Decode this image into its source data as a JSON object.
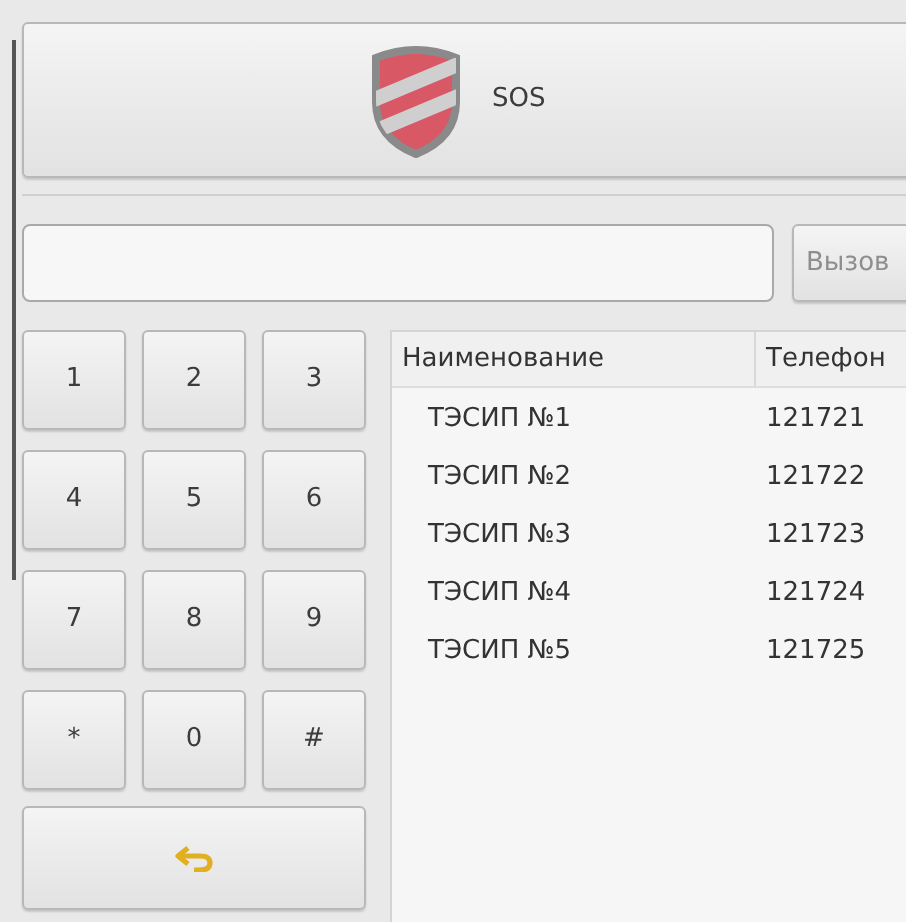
{
  "sos_button": {
    "label": "SOS"
  },
  "call_button": {
    "label": "Вызов",
    "disabled": true
  },
  "keypad": [
    "1",
    "2",
    "3",
    "4",
    "5",
    "6",
    "7",
    "8",
    "9",
    "*",
    "0",
    "#"
  ],
  "table": {
    "columns": [
      "Наименование",
      "Телефон"
    ],
    "rows": [
      [
        "ТЭСИП №1",
        "121721"
      ],
      [
        "ТЭСИП №2",
        "121722"
      ],
      [
        "ТЭСИП №3",
        "121723"
      ],
      [
        "ТЭСИП №4",
        "121724"
      ],
      [
        "ТЭСИП №5",
        "121725"
      ]
    ]
  }
}
